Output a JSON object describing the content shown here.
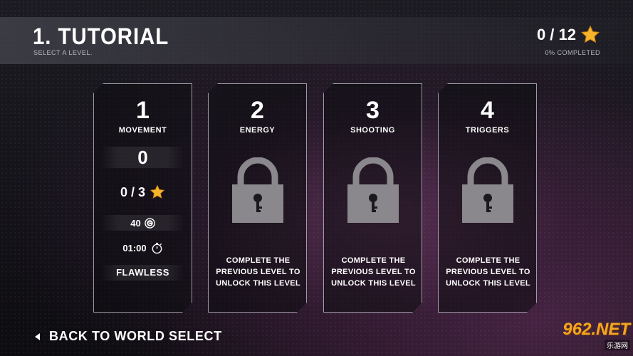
{
  "header": {
    "title": "1. TUTORIAL",
    "subtitle": "SELECT A LEVEL.",
    "stars": "0 / 12",
    "completed": "0% COMPLETED"
  },
  "levels": [
    {
      "number": "1",
      "name": "MOVEMENT",
      "unlocked": true,
      "score": "0",
      "stars": "0 / 3",
      "coins": "40",
      "time": "01:00",
      "badge": "FLAWLESS"
    },
    {
      "number": "2",
      "name": "ENERGY",
      "unlocked": false,
      "lock_message": [
        "COMPLETE THE",
        "PREVIOUS LEVEL TO",
        "UNLOCK THIS LEVEL"
      ]
    },
    {
      "number": "3",
      "name": "SHOOTING",
      "unlocked": false,
      "lock_message": [
        "COMPLETE THE",
        "PREVIOUS LEVEL TO",
        "UNLOCK THIS LEVEL"
      ]
    },
    {
      "number": "4",
      "name": "TRIGGERS",
      "unlocked": false,
      "lock_message": [
        "COMPLETE THE",
        "PREVIOUS LEVEL TO",
        "UNLOCK THIS LEVEL"
      ]
    }
  ],
  "footer": {
    "back_label": "BACK TO WORLD SELECT"
  },
  "watermark": {
    "main": "962.NET",
    "sub": "乐游网"
  },
  "colors": {
    "star": "#f5b42a",
    "lock": "#8a878d",
    "card_border": "#c8c8d2"
  },
  "icons": [
    "star-icon",
    "coin-icon",
    "stopwatch-icon",
    "padlock-icon",
    "back-arrow-icon"
  ]
}
